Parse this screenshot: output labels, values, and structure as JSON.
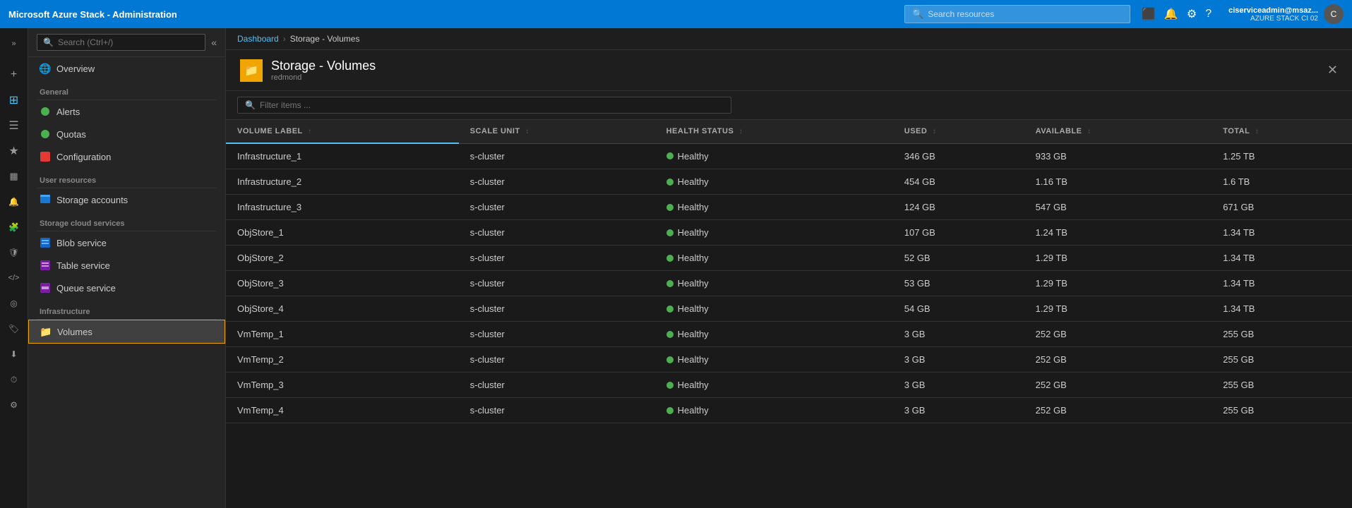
{
  "app": {
    "title": "Microsoft Azure Stack - Administration"
  },
  "topbar": {
    "title": "Microsoft Azure Stack - Administration",
    "search_placeholder": "Search resources",
    "user_name": "ciserviceadmin@msaz...",
    "user_tenant": "AZURE STACK CI 02",
    "avatar_initials": "C"
  },
  "breadcrumb": {
    "items": [
      "Dashboard",
      "Storage - Volumes"
    ]
  },
  "page_header": {
    "title": "Storage - Volumes",
    "subtitle": "redmond",
    "icon": "📁"
  },
  "filter": {
    "placeholder": "Filter items ..."
  },
  "table": {
    "columns": [
      {
        "key": "volume_label",
        "label": "VOLUME LABEL",
        "active": true
      },
      {
        "key": "scale_unit",
        "label": "SCALE UNIT"
      },
      {
        "key": "health_status",
        "label": "HEALTH STATUS"
      },
      {
        "key": "used",
        "label": "USED"
      },
      {
        "key": "available",
        "label": "AVAILABLE"
      },
      {
        "key": "total",
        "label": "TOTAL"
      }
    ],
    "rows": [
      {
        "volume_label": "Infrastructure_1",
        "scale_unit": "s-cluster",
        "health_status": "Healthy",
        "used": "346 GB",
        "available": "933 GB",
        "total": "1.25 TB"
      },
      {
        "volume_label": "Infrastructure_2",
        "scale_unit": "s-cluster",
        "health_status": "Healthy",
        "used": "454 GB",
        "available": "1.16 TB",
        "total": "1.6 TB"
      },
      {
        "volume_label": "Infrastructure_3",
        "scale_unit": "s-cluster",
        "health_status": "Healthy",
        "used": "124 GB",
        "available": "547 GB",
        "total": "671 GB"
      },
      {
        "volume_label": "ObjStore_1",
        "scale_unit": "s-cluster",
        "health_status": "Healthy",
        "used": "107 GB",
        "available": "1.24 TB",
        "total": "1.34 TB"
      },
      {
        "volume_label": "ObjStore_2",
        "scale_unit": "s-cluster",
        "health_status": "Healthy",
        "used": "52 GB",
        "available": "1.29 TB",
        "total": "1.34 TB"
      },
      {
        "volume_label": "ObjStore_3",
        "scale_unit": "s-cluster",
        "health_status": "Healthy",
        "used": "53 GB",
        "available": "1.29 TB",
        "total": "1.34 TB"
      },
      {
        "volume_label": "ObjStore_4",
        "scale_unit": "s-cluster",
        "health_status": "Healthy",
        "used": "54 GB",
        "available": "1.29 TB",
        "total": "1.34 TB"
      },
      {
        "volume_label": "VmTemp_1",
        "scale_unit": "s-cluster",
        "health_status": "Healthy",
        "used": "3 GB",
        "available": "252 GB",
        "total": "255 GB"
      },
      {
        "volume_label": "VmTemp_2",
        "scale_unit": "s-cluster",
        "health_status": "Healthy",
        "used": "3 GB",
        "available": "252 GB",
        "total": "255 GB"
      },
      {
        "volume_label": "VmTemp_3",
        "scale_unit": "s-cluster",
        "health_status": "Healthy",
        "used": "3 GB",
        "available": "252 GB",
        "total": "255 GB"
      },
      {
        "volume_label": "VmTemp_4",
        "scale_unit": "s-cluster",
        "health_status": "Healthy",
        "used": "3 GB",
        "available": "252 GB",
        "total": "255 GB"
      }
    ]
  },
  "sidebar": {
    "search_placeholder": "Search (Ctrl+/)",
    "nav_items": [
      {
        "id": "overview",
        "label": "Overview",
        "icon": "🌐",
        "section": null
      },
      {
        "id": "alerts",
        "label": "Alerts",
        "icon": "🟢",
        "section": "General"
      },
      {
        "id": "quotas",
        "label": "Quotas",
        "icon": "🟢",
        "section": null
      },
      {
        "id": "configuration",
        "label": "Configuration",
        "icon": "🔴",
        "section": null
      },
      {
        "id": "storage-accounts",
        "label": "Storage accounts",
        "icon": "🟦",
        "section": "User resources"
      },
      {
        "id": "blob-service",
        "label": "Blob service",
        "icon": "🟦",
        "section": "Storage cloud services"
      },
      {
        "id": "table-service",
        "label": "Table service",
        "icon": "🟪",
        "section": null
      },
      {
        "id": "queue-service",
        "label": "Queue service",
        "icon": "🟪",
        "section": null
      },
      {
        "id": "volumes",
        "label": "Volumes",
        "icon": "📁",
        "section": "Infrastructure"
      }
    ]
  },
  "icon_sidebar": {
    "icons": [
      {
        "id": "expand",
        "symbol": "»"
      },
      {
        "id": "plus",
        "symbol": "+"
      },
      {
        "id": "dashboard",
        "symbol": "⊞"
      },
      {
        "id": "list",
        "symbol": "☰"
      },
      {
        "id": "star",
        "symbol": "★"
      },
      {
        "id": "grid",
        "symbol": "⊟"
      },
      {
        "id": "bell",
        "symbol": "🔔"
      },
      {
        "id": "puzzle",
        "symbol": "🧩"
      },
      {
        "id": "shield",
        "symbol": "🛡"
      },
      {
        "id": "code",
        "symbol": "<>"
      },
      {
        "id": "circle",
        "symbol": "◎"
      },
      {
        "id": "tag",
        "symbol": "🏷"
      },
      {
        "id": "download",
        "symbol": "⬇"
      },
      {
        "id": "clock",
        "symbol": "⏱"
      },
      {
        "id": "settings",
        "symbol": "⚙"
      }
    ]
  }
}
